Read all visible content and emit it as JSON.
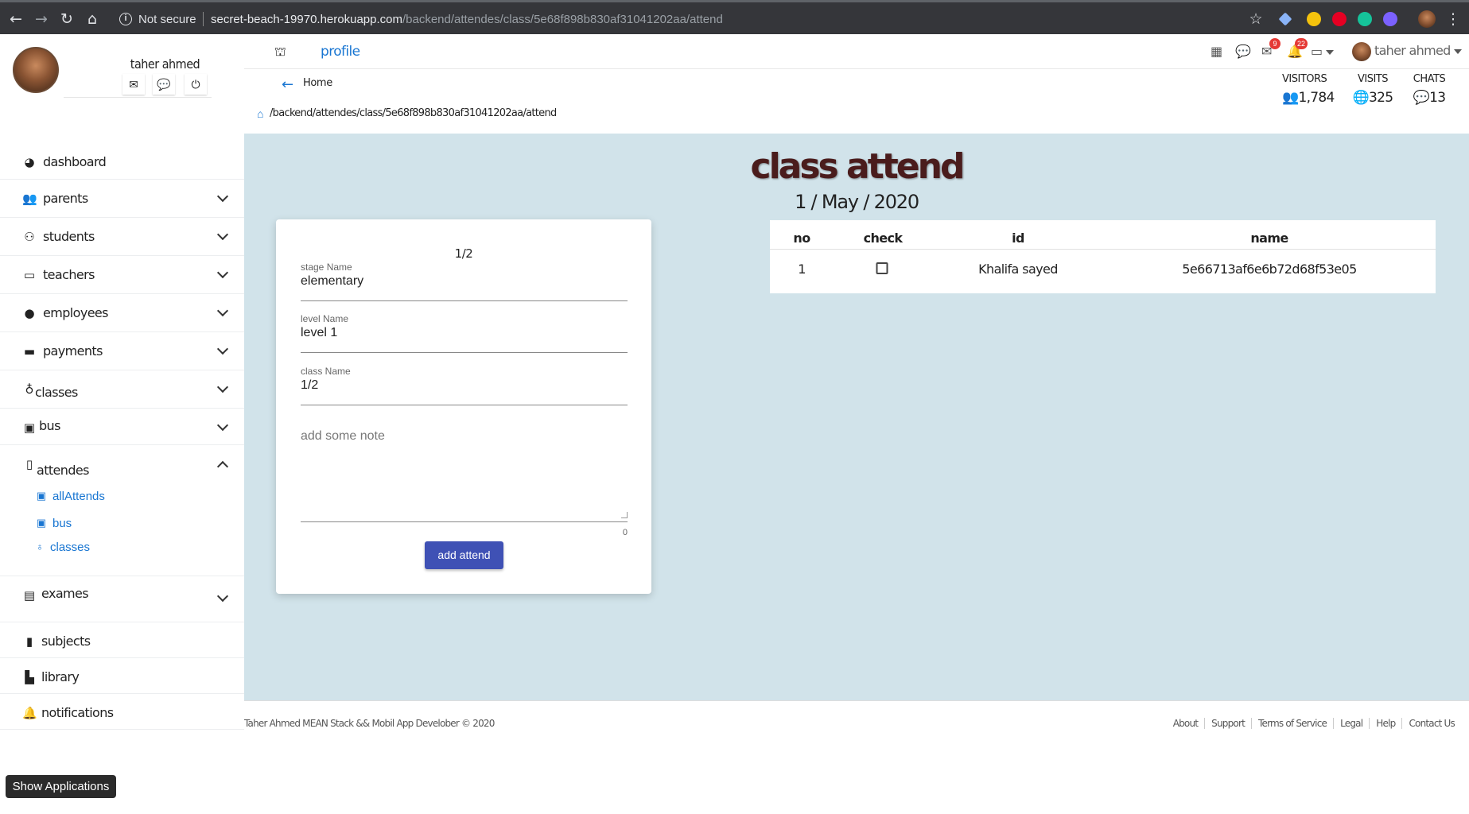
{
  "browser": {
    "secure_label": "Not secure",
    "url_domain": "secret-beach-19970.herokuapp.com",
    "url_path": "/backend/attendes/class/5e68f898b830af31041202aa/attend"
  },
  "sidebar": {
    "user_name": "taher ahmed",
    "items": [
      {
        "label": "dashboard",
        "icon": "speedometer-icon"
      },
      {
        "label": "parents",
        "icon": "users-icon"
      },
      {
        "label": "students",
        "icon": "students-icon"
      },
      {
        "label": "teachers",
        "icon": "teacher-icon"
      },
      {
        "label": "employees",
        "icon": "user-icon"
      },
      {
        "label": "payments",
        "icon": "wallet-icon"
      },
      {
        "label": "classes",
        "icon": "lightbulb-icon"
      },
      {
        "label": "bus",
        "icon": "bus-icon"
      },
      {
        "label": "attendes",
        "icon": "clipboard-icon"
      },
      {
        "label": "exames",
        "icon": "exam-icon"
      },
      {
        "label": "subjects",
        "icon": "book-icon"
      },
      {
        "label": "library",
        "icon": "library-icon"
      },
      {
        "label": "notifications",
        "icon": "bell-icon"
      }
    ],
    "attendes_sub": [
      {
        "label": "allAttends",
        "icon": "bus-icon"
      },
      {
        "label": "bus",
        "icon": "bus-icon"
      },
      {
        "label": "classes",
        "icon": "lightbulb-icon"
      }
    ]
  },
  "topbar": {
    "profile_label": "profile",
    "messages_badge": "9",
    "notifications_badge": "22",
    "user_name": "taher ahmed"
  },
  "header": {
    "back_label": "Home",
    "breadcrumb": "/backend/attendes/class/5e68f898b830af31041202aa/attend",
    "stats": [
      {
        "label": "VISITORS",
        "value": "1,784",
        "icon": "users-icon"
      },
      {
        "label": "VISITS",
        "value": "325",
        "icon": "globe-icon"
      },
      {
        "label": "CHATS",
        "value": "13",
        "icon": "chat-icon"
      }
    ]
  },
  "main": {
    "title": "class attend",
    "date": "1 / May / 2020",
    "form": {
      "card_title": "1/2",
      "fields": [
        {
          "label": "stage Name",
          "value": "elementary"
        },
        {
          "label": "level Name",
          "value": "level 1"
        },
        {
          "label": "class Name",
          "value": "1/2"
        }
      ],
      "note_placeholder": "add some note",
      "note_count": "0",
      "submit_label": "add attend"
    },
    "table": {
      "columns": [
        "no",
        "check",
        "id",
        "name"
      ],
      "rows": [
        {
          "no": "1",
          "checked": false,
          "id": "Khalifa sayed",
          "name": "5e66713af6e6b72d68f53e05"
        }
      ]
    }
  },
  "footer": {
    "copyright": "Taher Ahmed MEAN Stack && Mobil App Develober © 2020",
    "links": [
      "About",
      "Support",
      "Terms of Service",
      "Legal",
      "Help",
      "Contact Us"
    ]
  },
  "taskbar": {
    "show_apps_label": "Show Applications"
  }
}
